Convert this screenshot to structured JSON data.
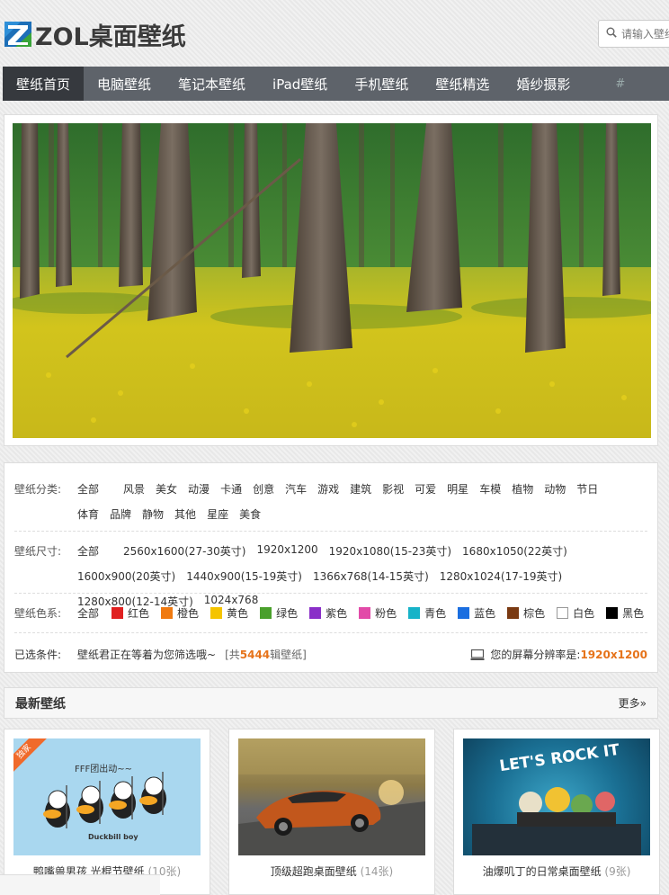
{
  "header": {
    "logo_text": "ZOL桌面壁纸",
    "search_placeholder": "请输入壁纸"
  },
  "nav": {
    "items": [
      {
        "label": "壁纸首页",
        "active": true
      },
      {
        "label": "电脑壁纸"
      },
      {
        "label": "笔记本壁纸"
      },
      {
        "label": "iPad壁纸"
      },
      {
        "label": "手机壁纸"
      },
      {
        "label": "壁纸精选"
      },
      {
        "label": "婚纱摄影"
      }
    ],
    "more": "#"
  },
  "filters": {
    "category_label": "壁纸分类:",
    "categories": [
      "全部",
      "风景",
      "美女",
      "动漫",
      "卡通",
      "创意",
      "汽车",
      "游戏",
      "建筑",
      "影视",
      "可爱",
      "明星",
      "车模",
      "植物",
      "动物",
      "节日",
      "体育",
      "品牌",
      "静物",
      "其他",
      "星座",
      "美食"
    ],
    "size_label": "壁纸尺寸:",
    "sizes": [
      "全部",
      "2560x1600(27-30英寸)",
      "1920x1200",
      "1920x1080(15-23英寸)",
      "1680x1050(22英寸)",
      "1600x900(20英寸)",
      "1440x900(15-19英寸)",
      "1366x768(14-15英寸)",
      "1280x1024(17-19英寸)",
      "1280x800(12-14英寸)",
      "1024x768"
    ],
    "color_label": "壁纸色系:",
    "color_all": "全部",
    "colors": [
      {
        "name": "红色",
        "hex": "#e02020"
      },
      {
        "name": "橙色",
        "hex": "#f07a10"
      },
      {
        "name": "黄色",
        "hex": "#f5c400"
      },
      {
        "name": "绿色",
        "hex": "#4aa02c"
      },
      {
        "name": "紫色",
        "hex": "#8a2fc8"
      },
      {
        "name": "粉色",
        "hex": "#e24aa8"
      },
      {
        "name": "青色",
        "hex": "#17b3c8"
      },
      {
        "name": "蓝色",
        "hex": "#1a6ee0"
      },
      {
        "name": "棕色",
        "hex": "#7a3a12"
      },
      {
        "name": "白色",
        "hex": "#ffffff"
      },
      {
        "name": "黑色",
        "hex": "#000000"
      }
    ],
    "selected_label": "已选条件:",
    "selected_text": "壁纸君正在等着为您筛选哦~",
    "count_prefix": "[共",
    "count": "5444",
    "count_suffix": "辑壁纸]",
    "resolution_label": "您的屏幕分辨率是:",
    "resolution": "1920x1200"
  },
  "latest": {
    "title": "最新壁纸",
    "more": "更多»",
    "badge": "独家",
    "cards": [
      {
        "title": "鸭嘴兽男孩 光棍节壁纸",
        "count": "(10张)",
        "img_text": "FFF团出动~~",
        "brand": "Duckbill boy"
      },
      {
        "title": "顶级超跑桌面壁纸",
        "count": "(14张)"
      },
      {
        "title": "油爆叽丁的日常桌面壁纸",
        "count": "(9张)",
        "img_text": "LET'S ROCK IT"
      }
    ]
  }
}
